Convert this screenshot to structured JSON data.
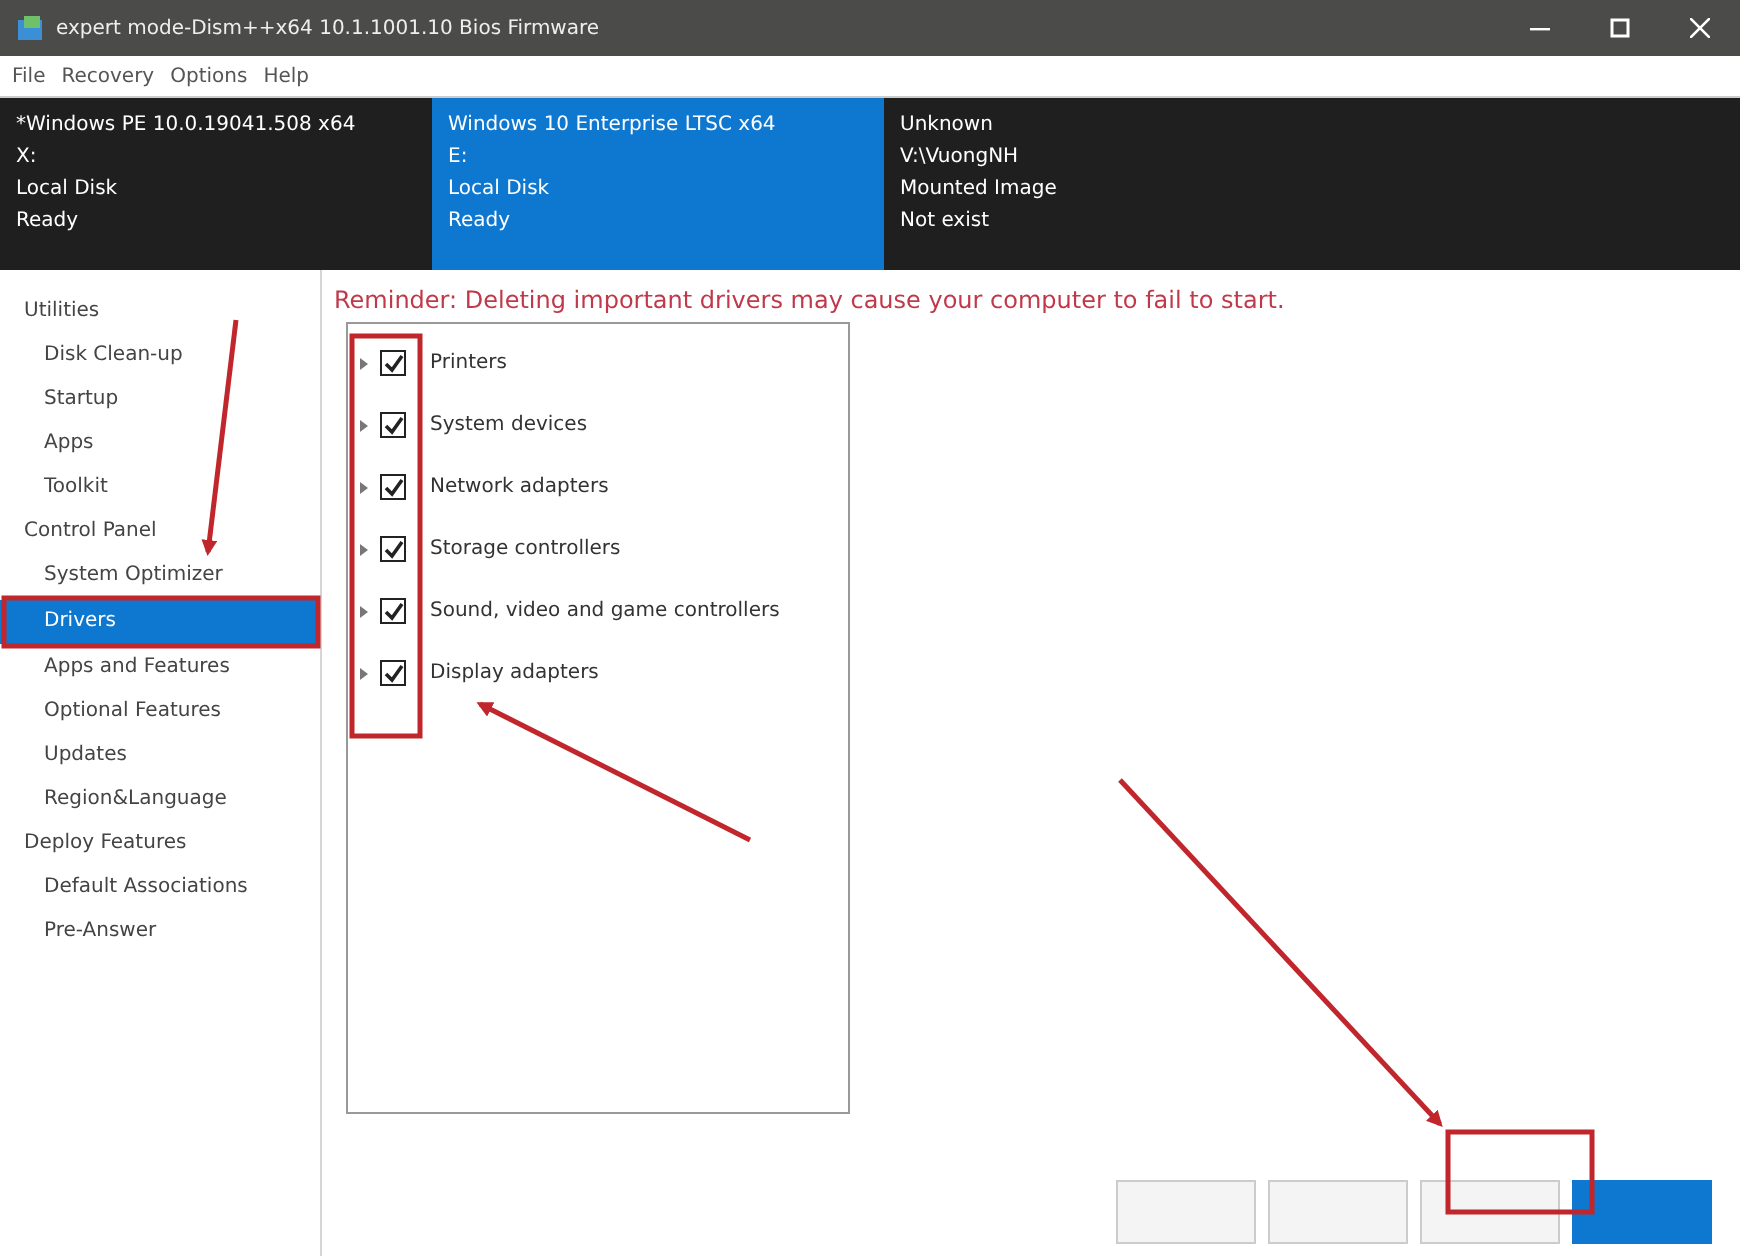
{
  "window": {
    "title": "expert mode-Dism++x64 10.1.1001.10 Bios Firmware"
  },
  "menu": [
    "File",
    "Recovery",
    "Options",
    "Help"
  ],
  "images": [
    {
      "lines": [
        "*Windows PE 10.0.19041.508 x64",
        "X:",
        "Local Disk",
        "Ready"
      ],
      "selected": false
    },
    {
      "lines": [
        "Windows 10 Enterprise LTSC x64",
        "E:",
        "Local Disk",
        "Ready"
      ],
      "selected": true
    },
    {
      "lines": [
        "Unknown",
        "V:\\VuongNH",
        "Mounted Image",
        "Not exist"
      ],
      "selected": false
    }
  ],
  "sidebar": [
    {
      "header": "Utilities",
      "items": [
        {
          "label": "Disk Clean-up",
          "selected": false
        },
        {
          "label": "Startup",
          "selected": false
        },
        {
          "label": "Apps",
          "selected": false
        },
        {
          "label": "Toolkit",
          "selected": false
        }
      ]
    },
    {
      "header": "Control Panel",
      "items": [
        {
          "label": "System Optimizer",
          "selected": false
        },
        {
          "label": "Drivers",
          "selected": true
        },
        {
          "label": "Apps and Features",
          "selected": false
        },
        {
          "label": "Optional Features",
          "selected": false
        },
        {
          "label": "Updates",
          "selected": false
        },
        {
          "label": "Region&Language",
          "selected": false
        }
      ]
    },
    {
      "header": "Deploy Features",
      "items": [
        {
          "label": "Default Associations",
          "selected": false
        },
        {
          "label": "Pre-Answer",
          "selected": false
        }
      ]
    }
  ],
  "reminder": "Reminder: Deleting important drivers may cause your computer to fail to start.",
  "drivers": [
    {
      "label": "Printers",
      "checked": true,
      "expanded": false
    },
    {
      "label": "System devices",
      "checked": true,
      "expanded": false
    },
    {
      "label": "Network adapters",
      "checked": true,
      "expanded": false
    },
    {
      "label": "Storage controllers",
      "checked": true,
      "expanded": false
    },
    {
      "label": "Sound, video and game controllers",
      "checked": true,
      "expanded": false
    },
    {
      "label": "Display adapters",
      "checked": true,
      "expanded": false
    }
  ]
}
